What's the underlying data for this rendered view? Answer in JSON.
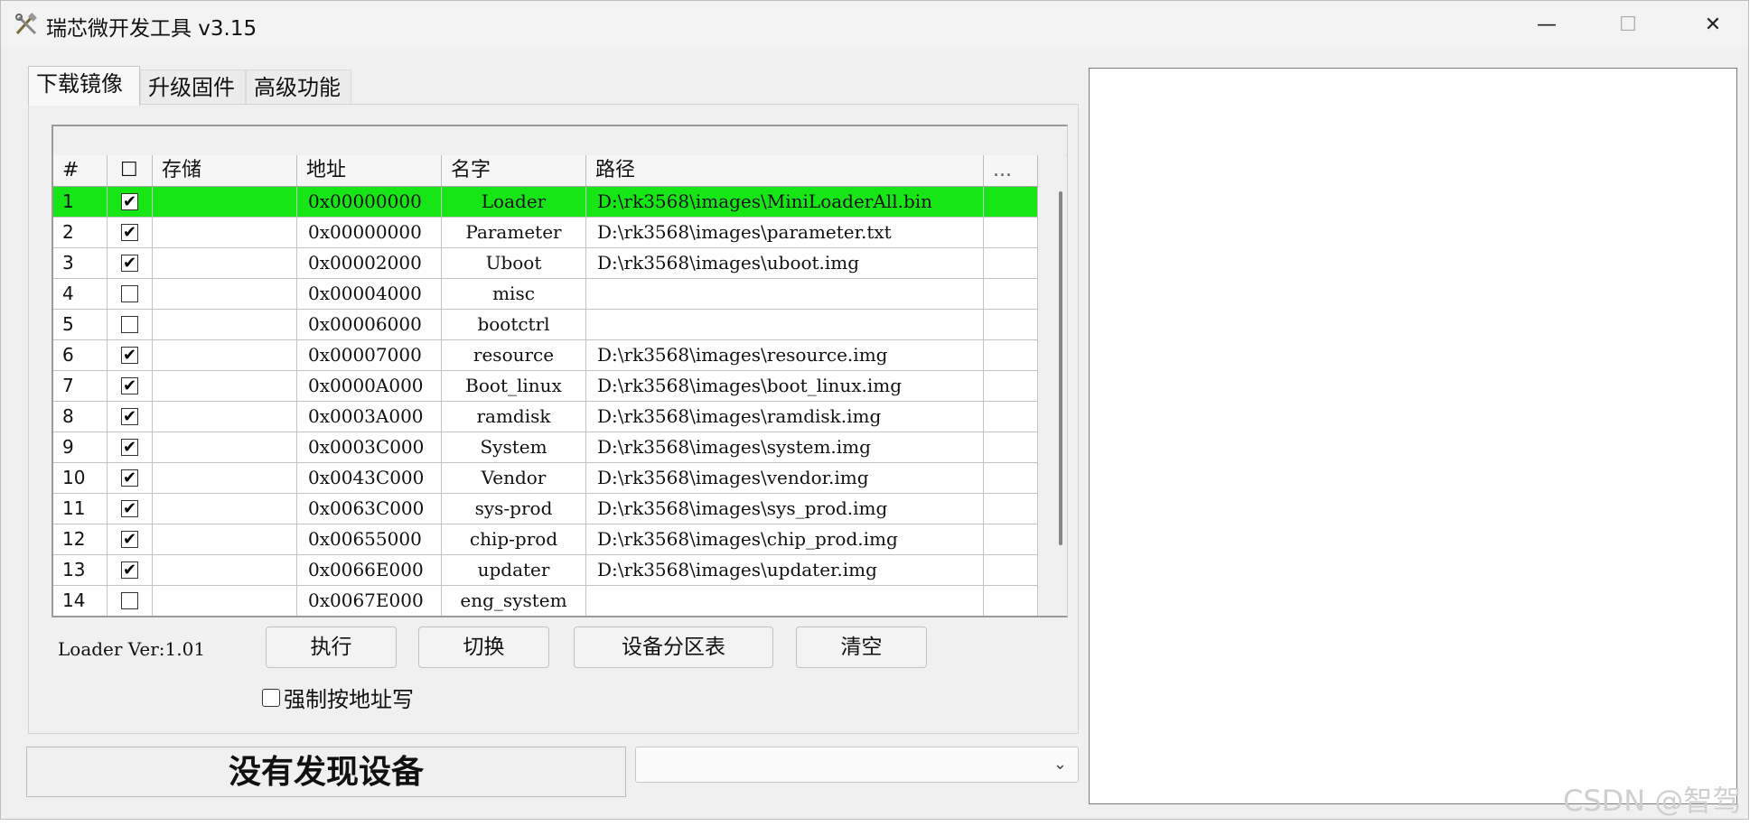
{
  "window": {
    "title": "瑞芯微开发工具 v3.15",
    "controls": {
      "minimize": "—",
      "maximize": "☐",
      "close": "✕"
    }
  },
  "tabs": [
    {
      "label": "下载镜像",
      "active": true
    },
    {
      "label": "升级固件",
      "active": false
    },
    {
      "label": "高级功能",
      "active": false
    }
  ],
  "table": {
    "headers": {
      "num": "#",
      "check": "☐",
      "storage": "存储",
      "address": "地址",
      "name": "名字",
      "path": "路径",
      "more": "..."
    },
    "rows": [
      {
        "num": "1",
        "checked": "✔",
        "storage": "",
        "address": "0x00000000",
        "name": "Loader",
        "path": "D:\\rk3568\\images\\MiniLoaderAll.bin",
        "highlight": true
      },
      {
        "num": "2",
        "checked": "✔",
        "storage": "",
        "address": "0x00000000",
        "name": "Parameter",
        "path": "D:\\rk3568\\images\\parameter.txt",
        "highlight": false
      },
      {
        "num": "3",
        "checked": "✔",
        "storage": "",
        "address": "0x00002000",
        "name": "Uboot",
        "path": "D:\\rk3568\\images\\uboot.img",
        "highlight": false
      },
      {
        "num": "4",
        "checked": "",
        "storage": "",
        "address": "0x00004000",
        "name": "misc",
        "path": "",
        "highlight": false
      },
      {
        "num": "5",
        "checked": "",
        "storage": "",
        "address": "0x00006000",
        "name": "bootctrl",
        "path": "",
        "highlight": false
      },
      {
        "num": "6",
        "checked": "✔",
        "storage": "",
        "address": "0x00007000",
        "name": "resource",
        "path": "D:\\rk3568\\images\\resource.img",
        "highlight": false
      },
      {
        "num": "7",
        "checked": "✔",
        "storage": "",
        "address": "0x0000A000",
        "name": "Boot_linux",
        "path": "D:\\rk3568\\images\\boot_linux.img",
        "highlight": false
      },
      {
        "num": "8",
        "checked": "✔",
        "storage": "",
        "address": "0x0003A000",
        "name": "ramdisk",
        "path": "D:\\rk3568\\images\\ramdisk.img",
        "highlight": false
      },
      {
        "num": "9",
        "checked": "✔",
        "storage": "",
        "address": "0x0003C000",
        "name": "System",
        "path": "D:\\rk3568\\images\\system.img",
        "highlight": false
      },
      {
        "num": "10",
        "checked": "✔",
        "storage": "",
        "address": "0x0043C000",
        "name": "Vendor",
        "path": "D:\\rk3568\\images\\vendor.img",
        "highlight": false
      },
      {
        "num": "11",
        "checked": "✔",
        "storage": "",
        "address": "0x0063C000",
        "name": "sys-prod",
        "path": "D:\\rk3568\\images\\sys_prod.img",
        "highlight": false
      },
      {
        "num": "12",
        "checked": "✔",
        "storage": "",
        "address": "0x00655000",
        "name": "chip-prod",
        "path": "D:\\rk3568\\images\\chip_prod.img",
        "highlight": false
      },
      {
        "num": "13",
        "checked": "✔",
        "storage": "",
        "address": "0x0066E000",
        "name": "updater",
        "path": "D:\\rk3568\\images\\updater.img",
        "highlight": false
      },
      {
        "num": "14",
        "checked": "",
        "storage": "",
        "address": "0x0067E000",
        "name": "eng_system",
        "path": "",
        "highlight": false
      }
    ]
  },
  "loader_version": "Loader Ver:1.01",
  "buttons": {
    "run": "执行",
    "switch": "切换",
    "partition_table": "设备分区表",
    "clear": "清空"
  },
  "force_write_label": "强制按地址写",
  "status_text": "没有发现设备",
  "device_combo_value": "",
  "watermark": "CSDN @智驾",
  "colors": {
    "highlight_row": "#16e616"
  }
}
